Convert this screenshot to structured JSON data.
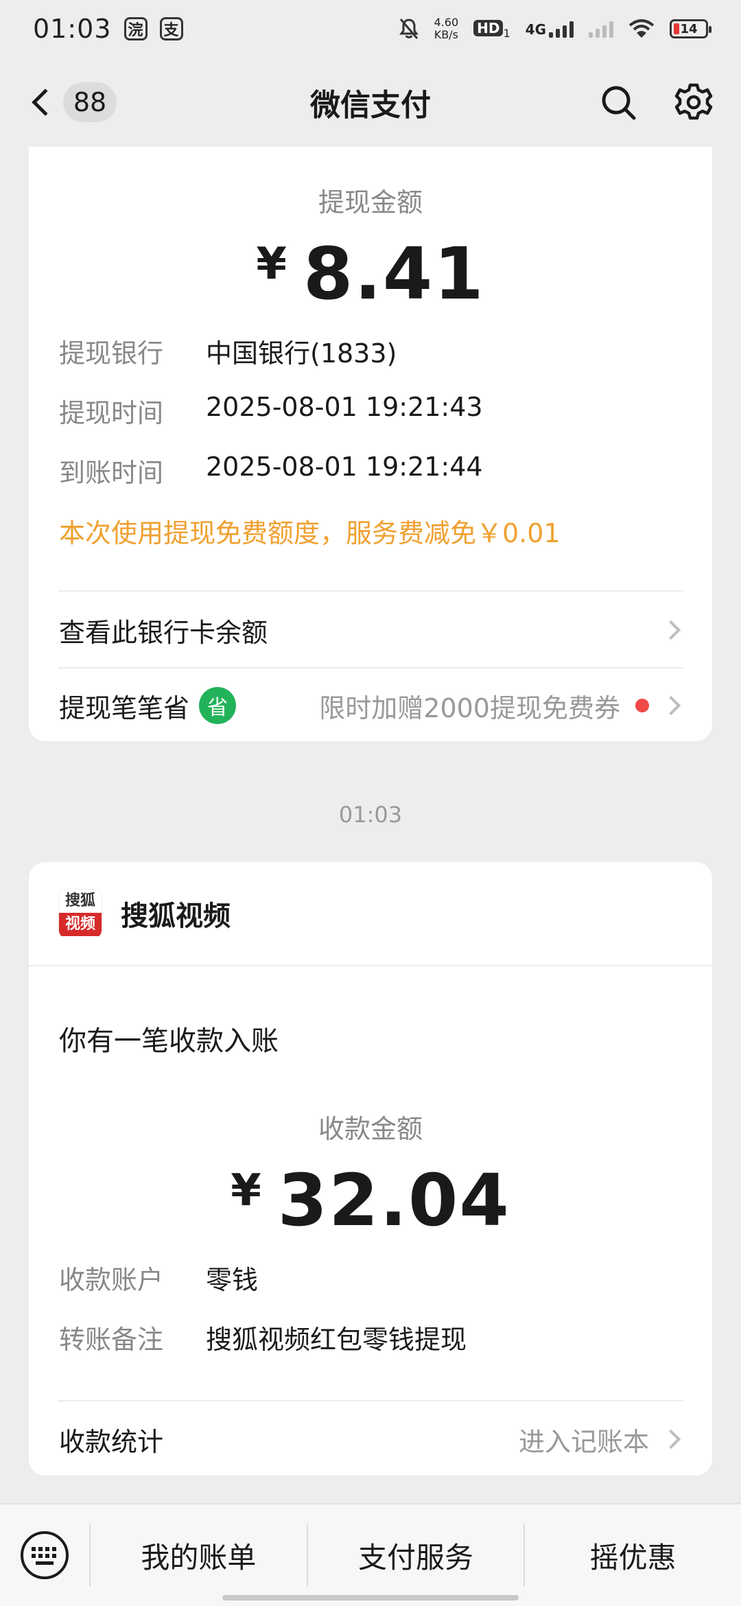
{
  "status_bar": {
    "time": "01:03",
    "app_icons": [
      "浣",
      "支"
    ],
    "net_speed": "4.60",
    "net_speed_unit": "KB/s",
    "hd_label": "HD",
    "hd_sim": "1",
    "network": "4G",
    "battery": "14"
  },
  "nav": {
    "back_badge": "88",
    "title": "微信支付"
  },
  "withdrawal": {
    "amount_label": "提现金额",
    "currency": "¥",
    "amount": "8.41",
    "bank_label": "提现银行",
    "bank_value": "中国银行(1833)",
    "time_label": "提现时间",
    "time_value": "2025-08-01 19:21:43",
    "arrival_label": "到账时间",
    "arrival_value": "2025-08-01 19:21:44",
    "notice": "本次使用提现免费额度，服务费减免￥0.01",
    "balance_link": "查看此银行卡余额",
    "save_label": "提现笔笔省",
    "save_badge": "省",
    "save_promo": "限时加赠2000提现免费券"
  },
  "timestamp": "01:03",
  "receipt": {
    "sender": "搜狐视频",
    "logo_top": "搜狐",
    "logo_bottom": "视频",
    "headline": "你有一笔收款入账",
    "amount_label": "收款金额",
    "currency": "¥",
    "amount": "32.04",
    "account_label": "收款账户",
    "account_value": "零钱",
    "memo_label": "转账备注",
    "memo_value": "搜狐视频红包零钱提现",
    "stats_label": "收款统计",
    "stats_link": "进入记账本"
  },
  "bottom_bar": {
    "items": [
      "我的账单",
      "支付服务",
      "摇优惠"
    ]
  }
}
